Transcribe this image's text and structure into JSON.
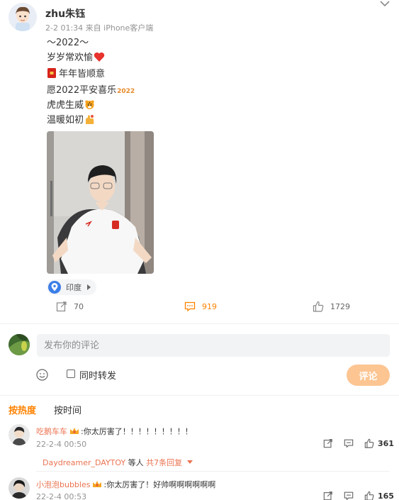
{
  "post": {
    "username": "zhu朱钰",
    "meta": "2-2 01:34  来自 iPhone客户端",
    "lines": [
      "～2022～",
      "岁岁常欢愉",
      "年年皆顺意",
      "愿2022平安喜乐",
      "虎虎生威",
      "温暖如初"
    ],
    "emoji_2022_text": "2022",
    "location": "印度",
    "reposts": "70",
    "comments": "919",
    "likes": "1729"
  },
  "composer": {
    "placeholder": "发布你的评论",
    "repost_label": "同时转发",
    "submit_label": "评论"
  },
  "sort": {
    "hot": "按热度",
    "time": "按时间"
  },
  "comments": [
    {
      "user": "吃鹅车车",
      "text": ":你太厉害了！！！！！！！！！",
      "time": "22-2-4 00:50",
      "likes": "361",
      "replies_user": "Daydreamer_DAYTOY",
      "replies_mid": " 等人 ",
      "replies_more": "共7条回复"
    },
    {
      "user": "小泡泡bubbles",
      "text": ":你太厉害了！好帅啊啊啊啊啊啊",
      "time": "22-2-4 00:53",
      "likes": "165"
    }
  ],
  "colors": {
    "accent": "#ff8200",
    "username_link": "#eb7350",
    "submit_bg": "#fcc592"
  },
  "icons": [
    "chevron-down-icon",
    "location-pin-icon",
    "repost-icon",
    "comment-icon",
    "like-icon",
    "smile-icon",
    "heart-emoji",
    "lucky-envelope-emoji",
    "tiger-emoji",
    "hands-emoji",
    "crown-badge-icon"
  ]
}
